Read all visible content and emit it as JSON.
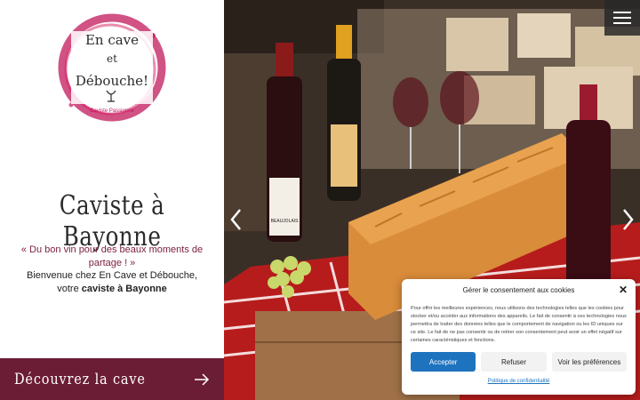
{
  "logo": {
    "line1": "En cave",
    "line2": "et",
    "line3": "Débouche!",
    "subtitle": "Caviste Passionné"
  },
  "headline": "Caviste à Bayonne",
  "tagline": "« Du bon vin pour des beaux moments de partage ! »",
  "welcome": {
    "line1": "Bienvenue chez En Cave et Débouche,",
    "line2_prefix": "votre",
    "line2_bold": "caviste à Bayonne"
  },
  "cta": {
    "label": "Découvrez la cave",
    "icon": "arrow-right-icon"
  },
  "hero": {
    "prev_icon": "chevron-left-icon",
    "next_icon": "chevron-right-icon",
    "menu_icon": "hamburger-menu-icon",
    "bottle_label_1": "BEAUJOLAIS"
  },
  "cookie": {
    "title": "Gérer le consentement aux cookies",
    "text": "Pour offrir les meilleures expériences, nous utilisons des technologies telles que les cookies pour stocker et/ou accéder aux informations des appareils. Le fait de consentir à ces technologies nous permettra de traiter des données telles que le comportement de navigation ou les ID uniques sur ce site. Le fait de ne pas consentir ou de retirer son consentement peut avoir un effet négatif sur certaines caractéristiques et fonctions.",
    "accept": "Accepter",
    "refuse": "Refuser",
    "prefs": "Voir les préférences",
    "policy": "Politique de confidentialité",
    "close_icon": "close-icon",
    "accent": "#1e73be"
  },
  "colors": {
    "brand": "#6b1d35",
    "logo_stain": "#c2185b"
  }
}
